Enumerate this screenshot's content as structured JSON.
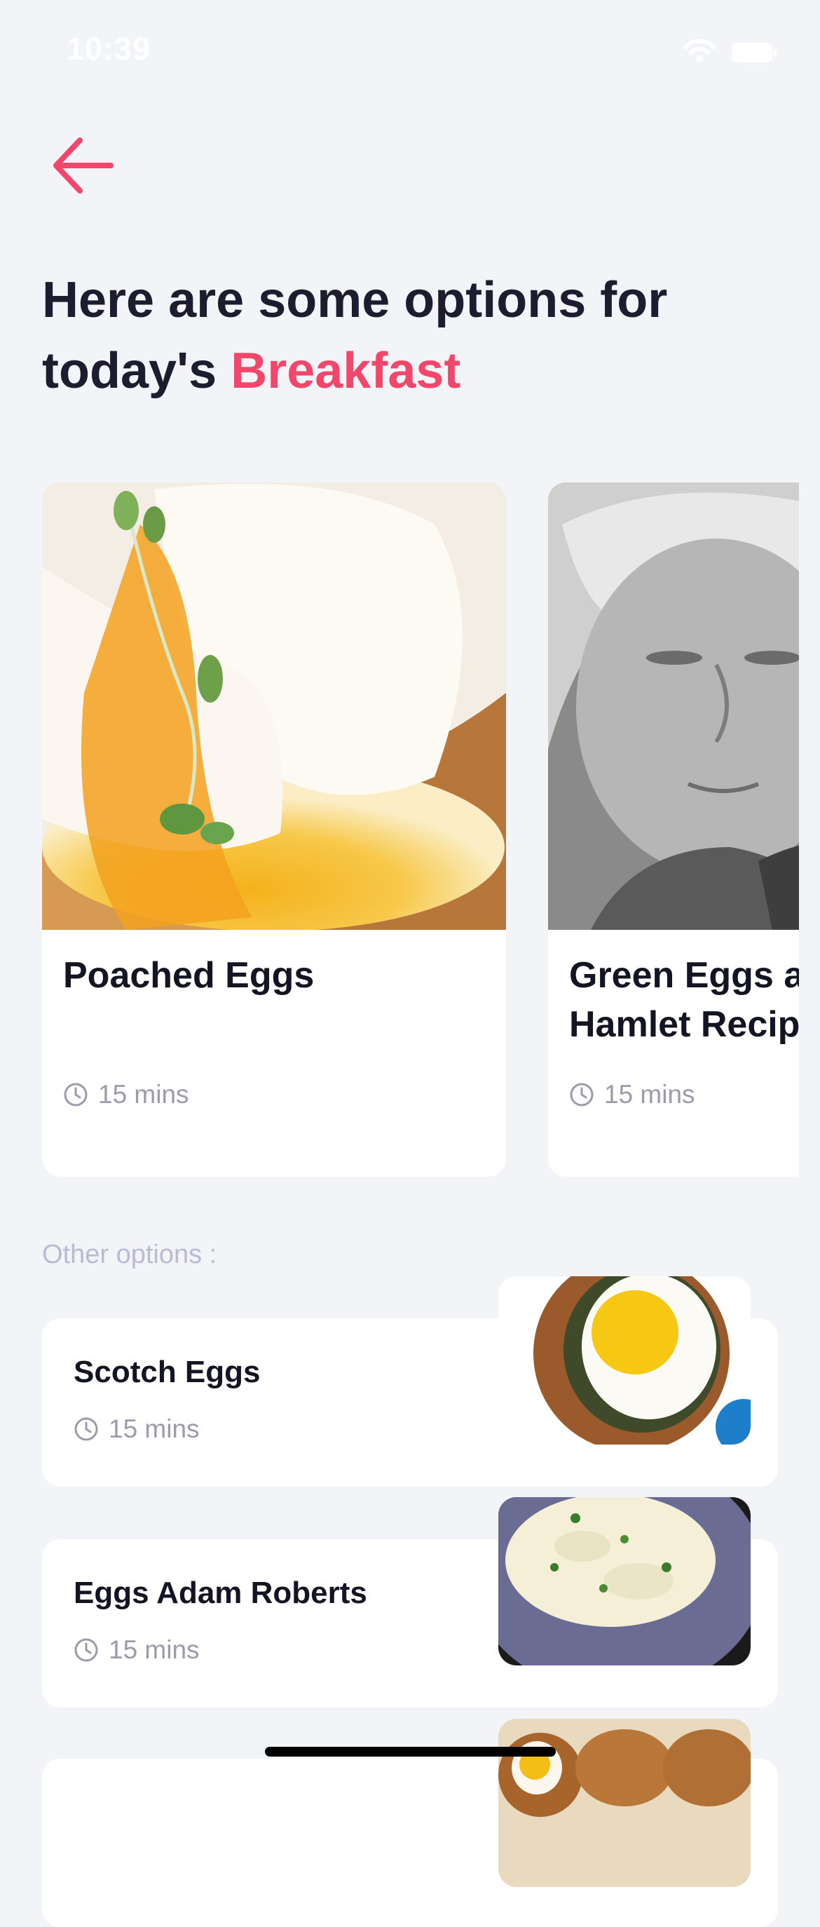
{
  "status_bar": {
    "time": "10:39"
  },
  "header": {
    "title_prefix": "Here are some options for today's ",
    "title_highlight": "Breakfast"
  },
  "featured": [
    {
      "title": "Poached Eggs",
      "duration": "15 mins"
    },
    {
      "title": "Green Eggs and\nHamlet Recipe",
      "duration": "15 mins"
    }
  ],
  "other_options": {
    "label": "Other options :",
    "items": [
      {
        "title": "Scotch Eggs",
        "duration": "15 mins"
      },
      {
        "title": "Eggs Adam Roberts",
        "duration": "15 mins"
      }
    ]
  },
  "colors": {
    "accent": "#f2476a",
    "background": "#f3f4f8",
    "title": "#1c1d2e",
    "muted": "#9a9bab",
    "section_label": "#b9bad6"
  },
  "icons": {
    "back": "arrow-left-icon",
    "duration": "clock-icon",
    "wifi": "wifi-icon",
    "battery": "battery-icon"
  }
}
